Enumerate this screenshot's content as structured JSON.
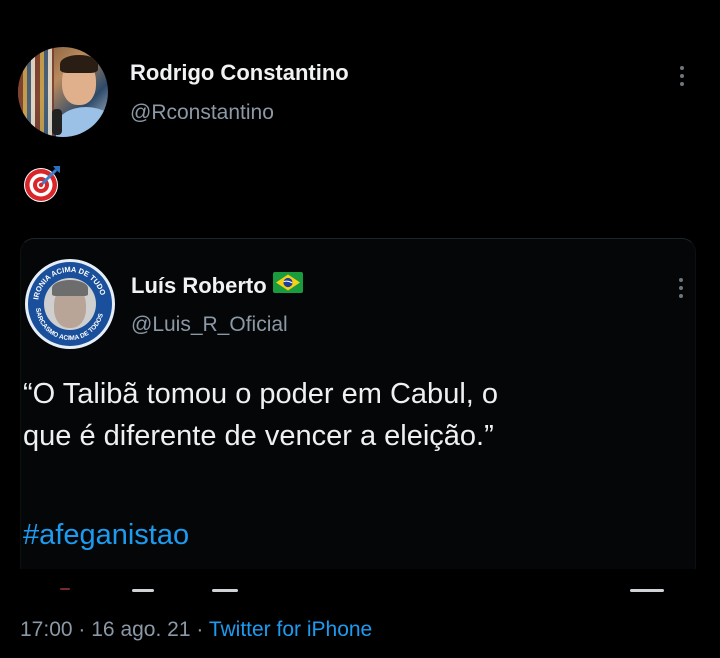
{
  "tweet": {
    "author_name": "Rodrigo Constantino",
    "author_handle": "@Rconstantino",
    "body_emoji": "direct-hit-target-emoji"
  },
  "quoted": {
    "author_name": "Luís Roberto",
    "author_handle": "@Luis_R_Oficial",
    "flag": "brazil-flag-icon",
    "avatar_ring_text_top": "IRONIA ACIMA DE TUDO",
    "avatar_ring_text_bottom": "SARCASMO ACIMA DE TODOS",
    "text_line1": "“O Talibã tomou o poder em Cabul, o",
    "text_line2": "que é diferente de vencer a eleição.”",
    "hashtag": "#afeganistao"
  },
  "meta": {
    "time": "17:00",
    "separator1": "·",
    "date": "16 ago. 21",
    "separator2": "·",
    "source": "Twitter for iPhone"
  },
  "colors": {
    "background": "#000000",
    "link": "#1d9bf0",
    "secondary_text": "#8b98a5"
  }
}
